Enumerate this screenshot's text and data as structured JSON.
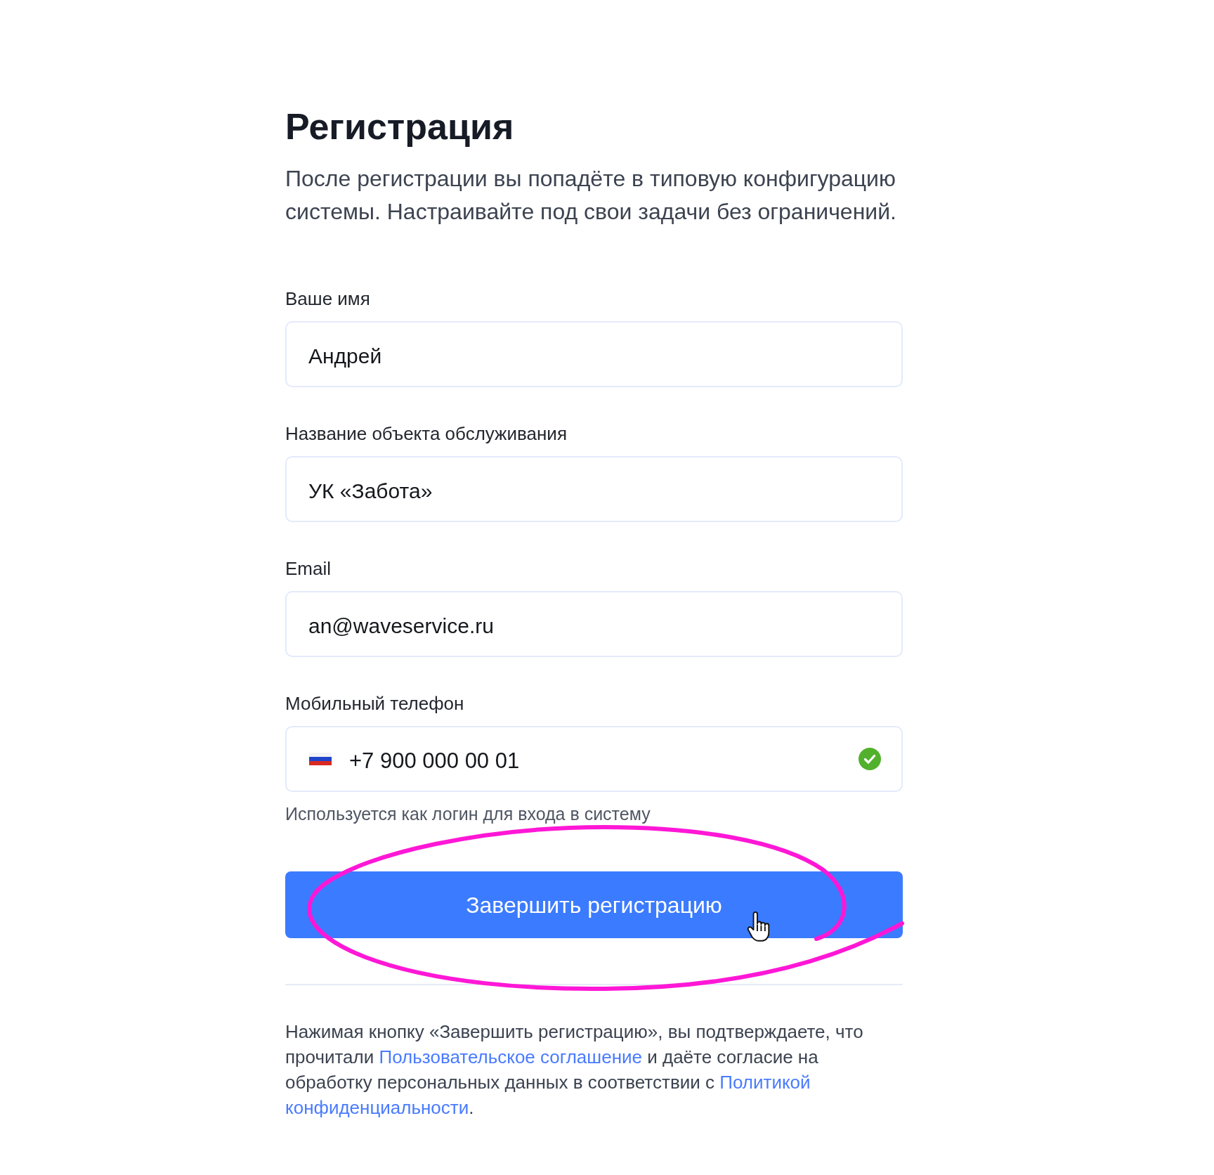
{
  "form": {
    "title": "Регистрация",
    "subtitle": "После регистрации вы попадёте в типовую конфигурацию системы. Настраивайте под свои задачи без ограничений."
  },
  "fields": [
    {
      "kind": "text",
      "label": "Ваше имя",
      "value": "Андрей"
    },
    {
      "kind": "text",
      "label": "Название объекта обслуживания",
      "value": "УК «Забота»"
    },
    {
      "kind": "text",
      "label": "Email",
      "value": "an@waveservice.ru"
    },
    {
      "kind": "phone",
      "label": "Мобильный телефон",
      "value": "+7 900 000 00 01",
      "valid": true,
      "hint": "Используется как логин для входа в систему"
    }
  ],
  "submit_button": {
    "label": "Завершить регистрацию"
  },
  "consent": {
    "parts": [
      {
        "kind": "text",
        "text": "Нажимая кнопку «Завершить регистрацию», вы подтверждаете, что прочитали "
      },
      {
        "kind": "link",
        "text": "Пользовательское соглашение"
      },
      {
        "kind": "text",
        "text": " и даёте согласие на обработку персональных данных в соответствии с "
      },
      {
        "kind": "link",
        "text": "Политикой"
      },
      {
        "kind": "link",
        "text": "конфиденциальности"
      },
      {
        "kind": "text",
        "text": "."
      }
    ]
  }
}
